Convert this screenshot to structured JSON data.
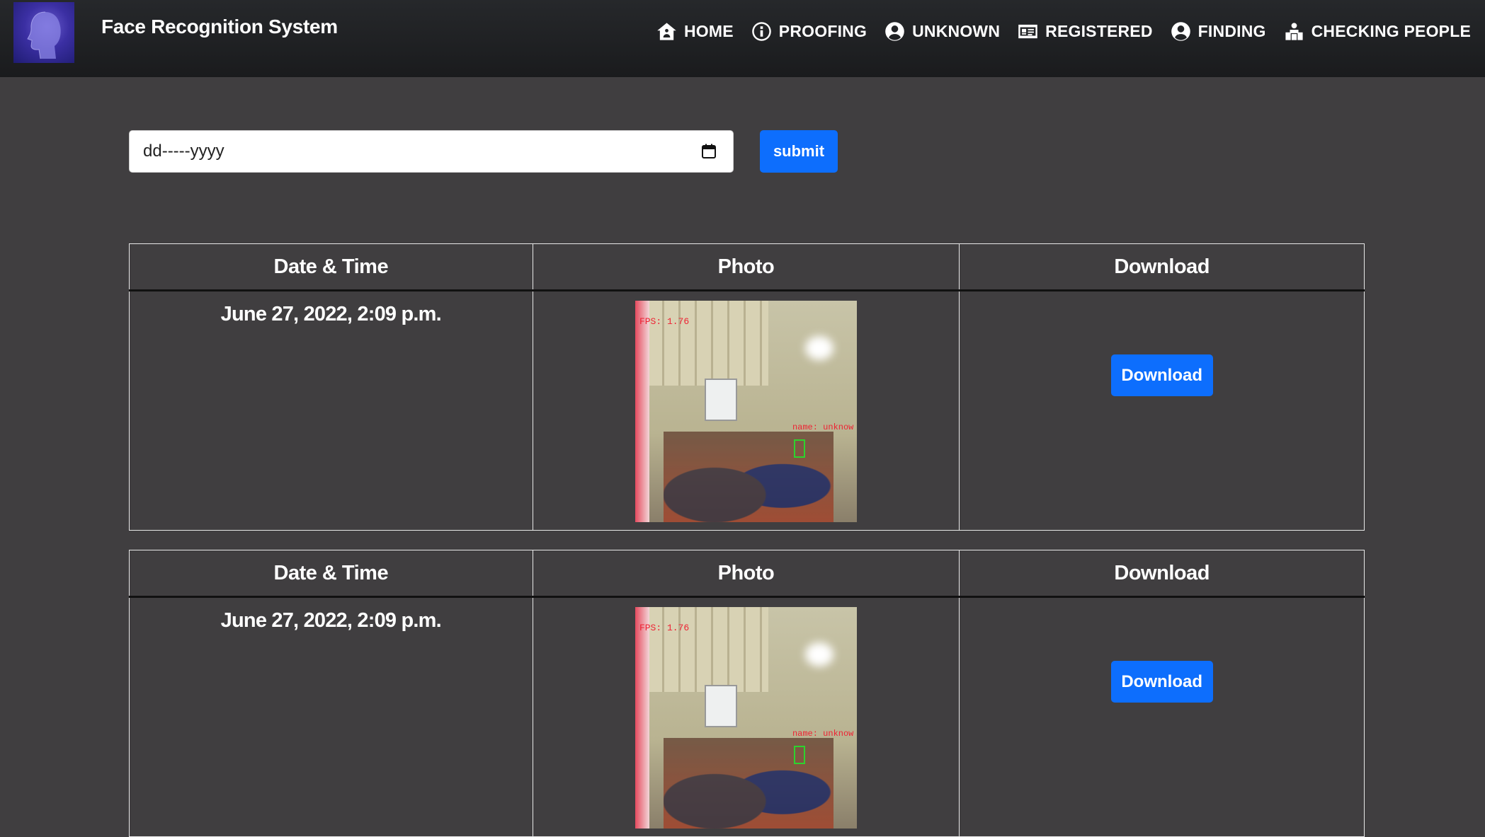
{
  "header": {
    "brand": "Face Recognition System",
    "nav": [
      {
        "label": "HOME",
        "icon": "home-icon"
      },
      {
        "label": "PROOFING",
        "icon": "info-icon"
      },
      {
        "label": "UNKNOWN",
        "icon": "user-circle-icon"
      },
      {
        "label": "REGISTERED",
        "icon": "id-card-icon"
      },
      {
        "label": "FINDING",
        "icon": "user-circle-icon"
      },
      {
        "label": "CHECKING PEOPLE",
        "icon": "person-box-icon"
      }
    ]
  },
  "filter": {
    "date_placeholder": "dd-----yyyy",
    "submit_label": "submit"
  },
  "records": [
    {
      "headers": {
        "date": "Date & Time",
        "photo": "Photo",
        "download": "Download"
      },
      "date": "June 27, 2022, 2:09 p.m.",
      "photo_tag": "FPS: 1.76",
      "photo_name_tag": "name: unknow",
      "download_label": "Download"
    },
    {
      "headers": {
        "date": "Date & Time",
        "photo": "Photo",
        "download": "Download"
      },
      "date": "June 27, 2022, 2:09 p.m.",
      "photo_tag": "FPS: 1.76",
      "photo_name_tag": "name: unknow",
      "download_label": "Download"
    }
  ],
  "colors": {
    "background": "#403e40",
    "navbar": "#1e1f21",
    "accent": "#0d6efd"
  }
}
